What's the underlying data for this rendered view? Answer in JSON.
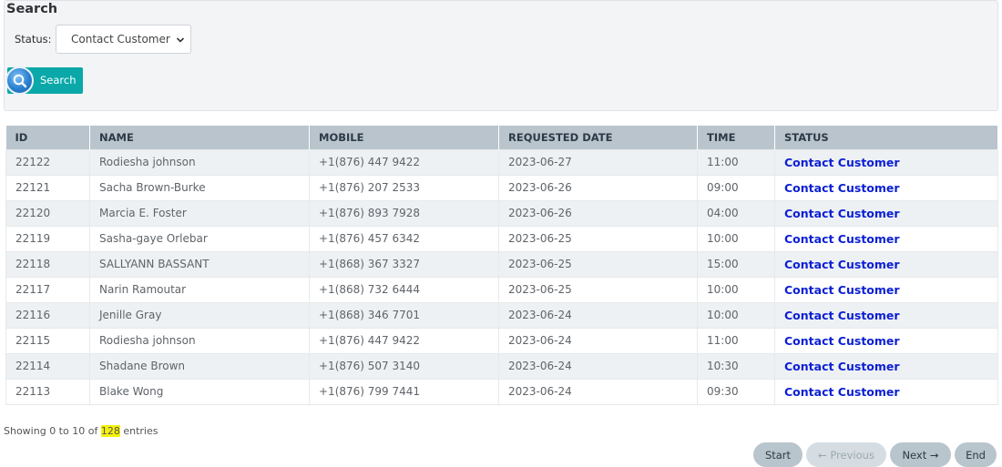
{
  "search": {
    "title": "Search",
    "status_label": "Status:",
    "status_value": "Contact Customer",
    "button_label": "Search"
  },
  "table": {
    "headers": [
      "ID",
      "NAME",
      "MOBILE",
      "REQUESTED DATE",
      "TIME",
      "STATUS"
    ],
    "rows": [
      [
        "22122",
        "Rodiesha johnson",
        "+1(876) 447 9422",
        "2023-06-27",
        "11:00",
        "Contact Customer"
      ],
      [
        "22121",
        "Sacha Brown-Burke",
        "+1(876) 207 2533",
        "2023-06-26",
        "09:00",
        "Contact Customer"
      ],
      [
        "22120",
        "Marcia E. Foster",
        "+1(876) 893 7928",
        "2023-06-26",
        "04:00",
        "Contact Customer"
      ],
      [
        "22119",
        "Sasha-gaye Orlebar",
        "+1(876) 457 6342",
        "2023-06-25",
        "10:00",
        "Contact Customer"
      ],
      [
        "22118",
        "SALLYANN BASSANT",
        "+1(868) 367 3327",
        "2023-06-25",
        "15:00",
        "Contact Customer"
      ],
      [
        "22117",
        "Narin Ramoutar",
        "+1(868) 732 6444",
        "2023-06-25",
        "10:00",
        "Contact Customer"
      ],
      [
        "22116",
        "Jenille Gray",
        "+1(868) 346 7701",
        "2023-06-24",
        "10:00",
        "Contact Customer"
      ],
      [
        "22115",
        "Rodiesha johnson",
        "+1(876) 447 9422",
        "2023-06-24",
        "11:00",
        "Contact Customer"
      ],
      [
        "22114",
        "Shadane Brown",
        "+1(876) 507 3140",
        "2023-06-24",
        "10:30",
        "Contact Customer"
      ],
      [
        "22113",
        "Blake Wong",
        "+1(876) 799 7441",
        "2023-06-24",
        "09:30",
        "Contact Customer"
      ]
    ]
  },
  "footer": {
    "info_prefix": "Showing 0 to 10 of ",
    "info_total": "128",
    "info_suffix": " entries",
    "start_label": "Start",
    "previous_label": "← Previous",
    "next_label": "Next →",
    "end_label": "End"
  },
  "colors": {
    "accent": "#0ba8a9",
    "link": "#0b1fd4",
    "header_bg": "#b9c4cc",
    "highlight": "#f4f20b"
  }
}
